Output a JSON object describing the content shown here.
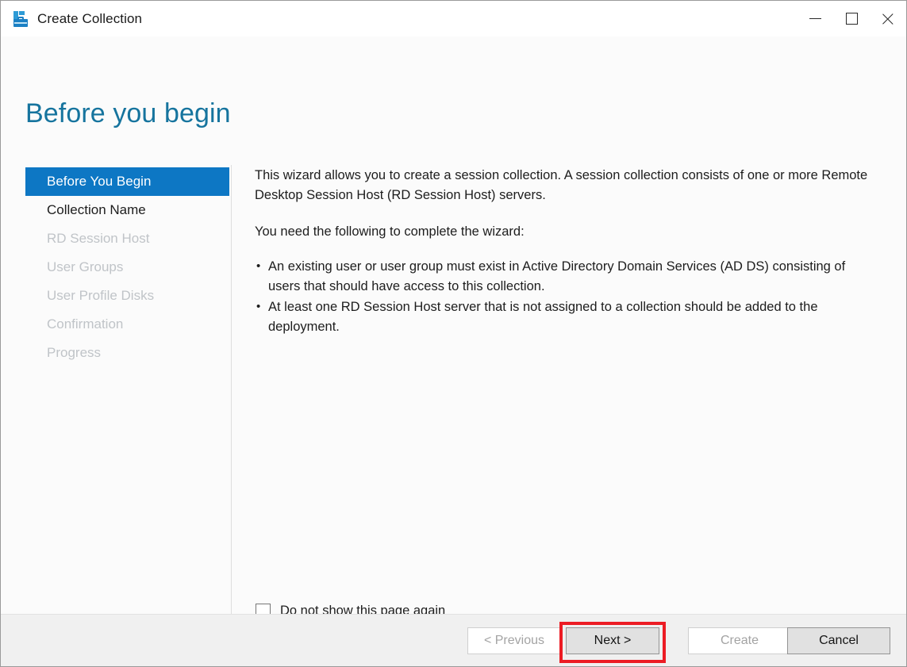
{
  "window": {
    "title": "Create Collection",
    "icon": "collection-server-icon",
    "controls": {
      "minimize": "minimize-icon",
      "maximize": "maximize-icon",
      "close": "close-icon"
    }
  },
  "page": {
    "heading": "Before you begin"
  },
  "sidebar": {
    "items": [
      {
        "label": "Before You Begin",
        "state": "selected"
      },
      {
        "label": "Collection Name",
        "state": "enabled"
      },
      {
        "label": "RD Session Host",
        "state": "disabled"
      },
      {
        "label": "User Groups",
        "state": "disabled"
      },
      {
        "label": "User Profile Disks",
        "state": "disabled"
      },
      {
        "label": "Confirmation",
        "state": "disabled"
      },
      {
        "label": "Progress",
        "state": "disabled"
      }
    ]
  },
  "content": {
    "intro": "This wizard allows you to create a session collection. A session collection consists of one or more Remote Desktop Session Host (RD Session Host) servers.",
    "requirements_heading": "You need the following to complete the wizard:",
    "bullets": [
      "An existing user or user group must exist in Active Directory Domain Services (AD DS) consisting of users that should have access to this collection.",
      "At least one RD Session Host server that is not assigned to a collection should be added to the deployment."
    ]
  },
  "checkbox": {
    "label": "Do not show this page again",
    "checked": false
  },
  "footer": {
    "buttons": [
      {
        "label": "< Previous",
        "state": "disabled"
      },
      {
        "label": "Next >",
        "state": "enabled"
      },
      {
        "label": "Create",
        "state": "disabled"
      },
      {
        "label": "Cancel",
        "state": "enabled"
      }
    ]
  },
  "annotation": {
    "highlight_color": "#ec1c24",
    "target": "Next >"
  },
  "colors": {
    "accent_blue": "#0d77c4",
    "heading_blue": "#16749e",
    "disabled_text": "#c0c4c8",
    "footer_bg": "#f0f0f0",
    "content_bg": "#fbfbfb"
  }
}
